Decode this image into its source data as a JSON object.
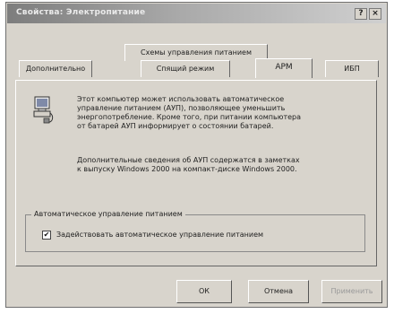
{
  "window": {
    "title": "Свойства: Электропитание",
    "help_label": "?",
    "close_label": "×"
  },
  "tabs": [
    {
      "label": "Схемы управления питанием"
    },
    {
      "label": "Дополнительно"
    },
    {
      "label": "Спящий режим"
    },
    {
      "label": "APM"
    },
    {
      "label": "ИБП"
    }
  ],
  "content": {
    "icon": "computer-monitor-icon",
    "paragraph1": [
      "Этот компьютер может использовать автоматическое",
      "управление питанием (АУП), позволяющее уменьшить",
      "энергопотребление. Кроме того, при питании компьютера",
      "от батарей АУП информирует о состоянии батарей."
    ],
    "paragraph2": [
      "Дополнительные сведения об АУП содержатся в заметках",
      "к выпуску Windows 2000 на компакт-диске Windows 2000."
    ],
    "group_label": "Автоматическое управление питанием",
    "checkbox_label": "Задействовать автоматическое управление питанием",
    "checkbox_checked": true
  },
  "buttons": {
    "ok": "ОК",
    "cancel": "Отмена",
    "apply": "Применить"
  }
}
